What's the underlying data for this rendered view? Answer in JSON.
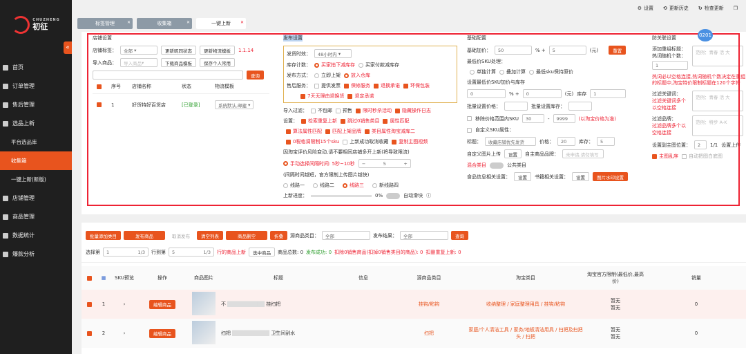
{
  "brand": {
    "name": "初征",
    "sub": "CHUZHENG"
  },
  "sidebar": {
    "items": [
      {
        "label": "首页"
      },
      {
        "label": "订单管理"
      },
      {
        "label": "售后管理"
      },
      {
        "label": "选品上新"
      },
      {
        "label": "平台选品库"
      },
      {
        "label": "收集箱"
      },
      {
        "label": "一键上新(新版)"
      },
      {
        "label": "店铺管理"
      },
      {
        "label": "商品管理"
      },
      {
        "label": "数据统计"
      },
      {
        "label": "爆款分析"
      }
    ]
  },
  "topbar": {
    "settings": "设置",
    "history": "更新历史",
    "check": "检查更新"
  },
  "tabs": [
    "标签管理",
    "收集箱",
    "一键上新"
  ],
  "store": {
    "title": "店铺设置",
    "tag_label": "店铺标签：",
    "tag_value": "全部",
    "btn_update": "更新昵同状态",
    "btn_logistics": "更新物流模板",
    "version": "1.1.14",
    "import_label": "导入商品：",
    "import_ph": "导入商品",
    "btn_download": "下载商品模板",
    "btn_save": "保存个人常用",
    "btn_search": "查询",
    "headers": [
      "序号",
      "店铺名称",
      "状态",
      "物流模板"
    ],
    "row": {
      "no": "1",
      "name": "好货特好百货店",
      "status": "[已登录]",
      "logistics": "系统默认,邮建"
    }
  },
  "publish": {
    "title": "发布设置",
    "time_label": "发货时效：",
    "time_value": "48小时内",
    "stock_label": "库存计数：",
    "stock_opt1": "买家拍下减库存",
    "stock_opt2": "买家付款减库存",
    "mode_label": "发布方式：",
    "mode_opt1": "立即上架",
    "mode_opt2": "放入仓库",
    "service_label": "售后服务：",
    "service_opts": [
      "提供发票",
      "保修服务",
      "退换承诺",
      "环保包装"
    ],
    "return_opt": "7天无理由退换货",
    "resale_opt": "退定承诺",
    "filter_label": "导入过滤：",
    "filter_opts": [
      "不包邮",
      "预售",
      "限时秒杀活动",
      "隐藏操作日志"
    ],
    "set_label": "设置：",
    "set_opts": [
      "检索重复上新",
      "跳过0销售类目",
      "属性匹配",
      "算法属性匹配",
      "匹配上架品牌",
      "类目属性淘宝减库二",
      "0税格调限制15个sku",
      "上新成功取消收藏",
      "复制主图视频"
    ],
    "risk_note": "因淘宝评价风险变动,请不要相同店铺多开上新(将导致限流)",
    "manual_opt": "手动选择间隔时间: 5秒~10秒",
    "interval": "5",
    "note2": "(间隔时间越短，官方限制上传图片越快)",
    "lines": [
      "线路一",
      "线路二",
      "线路三",
      "新线路四"
    ],
    "progress_label": "上新进度：",
    "progress": "0%",
    "auto_label": "自动滑块"
  },
  "basic": {
    "title": "基础配置",
    "price_label": "基础加价：",
    "price_pct": "50",
    "price_add": "5",
    "unit": "(元)",
    "reset": "重置",
    "sku_label": "最低价SKU处理：",
    "sku_opts": [
      "单独计算",
      "叠加计算",
      "最低sku保持原价"
    ],
    "sku_price_label": "设置最低价SKU加价与库存",
    "sku_pct": "0",
    "sku_add": "0",
    "stock_label": "库存",
    "stock": "1",
    "batch_price": "批量设置价格：",
    "batch_stock": "批量设置库存：",
    "remove_label": "移除价格范围内SKU",
    "range_from": "30",
    "range_to": "9999",
    "range_note": "(以淘宝价格为准)",
    "custom_sku": "自定义SKU属性：",
    "title_label": "标题：",
    "title_value": "收藏店铺优先发货",
    "price2_label": "价格：",
    "price2": "20",
    "stock2_label": "库存：",
    "stock2": "5",
    "pic_label": "自定义图片上传",
    "pic_btn": "设置",
    "brand_label": "自主商品品牌：",
    "brand_ph": "未申请,请勿填写",
    "mix_label": "混合类目",
    "public_label": "公共类目",
    "food_label": "食品信息相关设置：",
    "food_btn": "设置",
    "book_label": "书籍相关设置：",
    "book_btn": "设置",
    "watermark_btn": "图片水印设置"
  },
  "guard": {
    "title": "防关联设置",
    "add_title_label": "添加重组标题：",
    "hot_label": "热词随机个数：",
    "hot_count": "1",
    "hot_ph": "范例：青春 活 大",
    "warn": "热词必以空格连接,热词随机个数决定在重组的标题中,淘宝特价限制标题在120个字符",
    "filter_label": "过滤关键词：",
    "filter_note": "过滤关键词多个以空格连接",
    "filter_ph": "范例：青春 活 大",
    "brand_label": "过滤品牌：",
    "brand_note": "过滤品牌多个以空格连接",
    "brand_ph": "范例：特步 A-K",
    "img_pos_label": "设置副主图位置：",
    "img_pos": "2",
    "img_pos_max": "1/1",
    "img_pos_suffix": "设置上传",
    "main_random": "主图乱序",
    "auto_white": "自动把图白底图",
    "badge": "0201"
  },
  "toolbar": {
    "btn_batch_cat": "批量添加类目",
    "btn_publish": "发布商品",
    "btn_cancel": "取消发布",
    "btn_clear": "清空列表",
    "btn_delete": "商品删空",
    "btn_fold": "折叠",
    "source_cat": "源商品类目：",
    "source_val": "全部",
    "publish_result": "发布结果：",
    "publish_val": "全部",
    "search": "查询",
    "select_label": "选择第",
    "select_val": "1",
    "select_max": "1/3",
    "row_label": "行到第",
    "row_to": "5",
    "row_max": "1/3",
    "row_suffix": "行的商品上新",
    "btn_selected": "选中商品",
    "total": "商品总数: 0",
    "success": "发布成功: 0",
    "failed": "扣除0销售商品(扣掉0销售类目的商品): 0",
    "dup": "扣删重复上新: 0"
  },
  "table": {
    "headers": [
      "SKU预览",
      "操作",
      "商品图片",
      "标题",
      "信息",
      "源商品类目",
      "淘宝类目",
      "淘宝官方限制(最低价,最高价)",
      "销量"
    ],
    "rows": [
      {
        "no": "1",
        "op": "编辑商品",
        "title": "不",
        "title_tail": "挂扫把",
        "source": "挂钩/粘钩",
        "taobao": "收纳整理 / 家庭整理用具 / 挂钩/粘钩",
        "limit1": "暂无",
        "limit2": "暂无",
        "sales": "0"
      },
      {
        "no": "2",
        "op": "编辑商品",
        "title": "扫把",
        "title_tail": "卫生间刮水",
        "source": "扫把",
        "taobao": "家庭/个人清洁工具 / 家务/地板清洁用具 / 扫把及扫把头 / 扫把",
        "limit1": "暂无",
        "limit2": "暂无",
        "sales": "0"
      }
    ]
  },
  "colors": {
    "accent": "#e8541e",
    "sidebar": "#1f1f1f",
    "highlight": "#e23"
  }
}
